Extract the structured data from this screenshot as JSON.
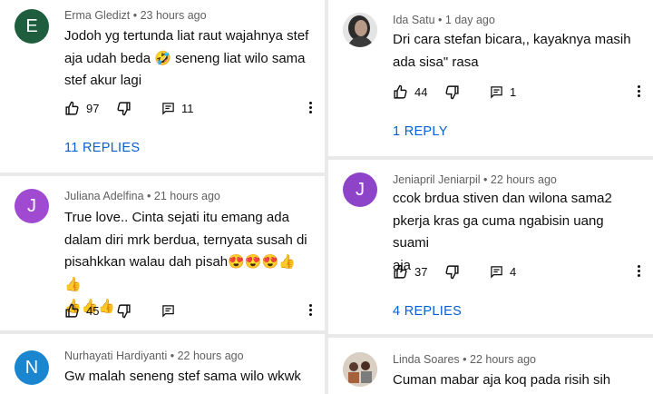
{
  "left": {
    "comments": [
      {
        "avatar_letter": "E",
        "avatar_color": "#1e5e3e",
        "author": "Erma Gledizt",
        "time": "23 hours ago",
        "text_lines": [
          "Jodoh yg tertunda liat raut wajahnya stef",
          "aja udah beda 🤣 seneng liat wilo sama",
          "stef akur lagi"
        ],
        "likes": "97",
        "reply_count": "11",
        "replies_label": "11 REPLIES"
      },
      {
        "avatar_letter": "J",
        "avatar_color": "#a04ad1",
        "author": "Juliana Adelfina",
        "time": "21 hours ago",
        "text_lines": [
          "True love.. Cinta sejati itu emang ada",
          "dalam diri mrk berdua, ternyata susah di",
          "pisahkkan walau dah pisah😍😍😍👍👍",
          "👍👍👍"
        ],
        "likes": "45",
        "reply_count": ""
      },
      {
        "avatar_letter": "N",
        "avatar_color": "#1a86d0",
        "author": "Nurhayati Hardiyanti",
        "time": "22 hours ago",
        "text_lines": [
          "Gw malah seneng stef sama wilo wkwk"
        ]
      }
    ]
  },
  "right": {
    "comments": [
      {
        "author": "Ida Satu",
        "time": "1 day ago",
        "text_lines": [
          "Dri cara stefan bicara,, kayaknya masih",
          "ada sisa\" rasa"
        ],
        "likes": "44",
        "reply_count": "1",
        "replies_label": "1 REPLY"
      },
      {
        "avatar_letter": "J",
        "avatar_color": "#8e44c8",
        "author": "Jeniapril Jeniarpil",
        "time": "22 hours ago",
        "text_lines": [
          "ccok brdua stiven dan wilona sama2",
          "pkerja kras ga cuma ngabisin uang suami",
          "aja"
        ],
        "likes": "37",
        "reply_count": "4",
        "replies_label": "4 REPLIES"
      },
      {
        "author": "Linda Soares",
        "time": "22 hours ago",
        "text_lines": [
          "Cuman mabar aja koq pada risih sih"
        ]
      }
    ]
  },
  "icons": {
    "like": "thumbs-up-icon",
    "dislike": "thumbs-down-icon",
    "reply": "comment-icon",
    "more": "more-vertical-icon"
  }
}
